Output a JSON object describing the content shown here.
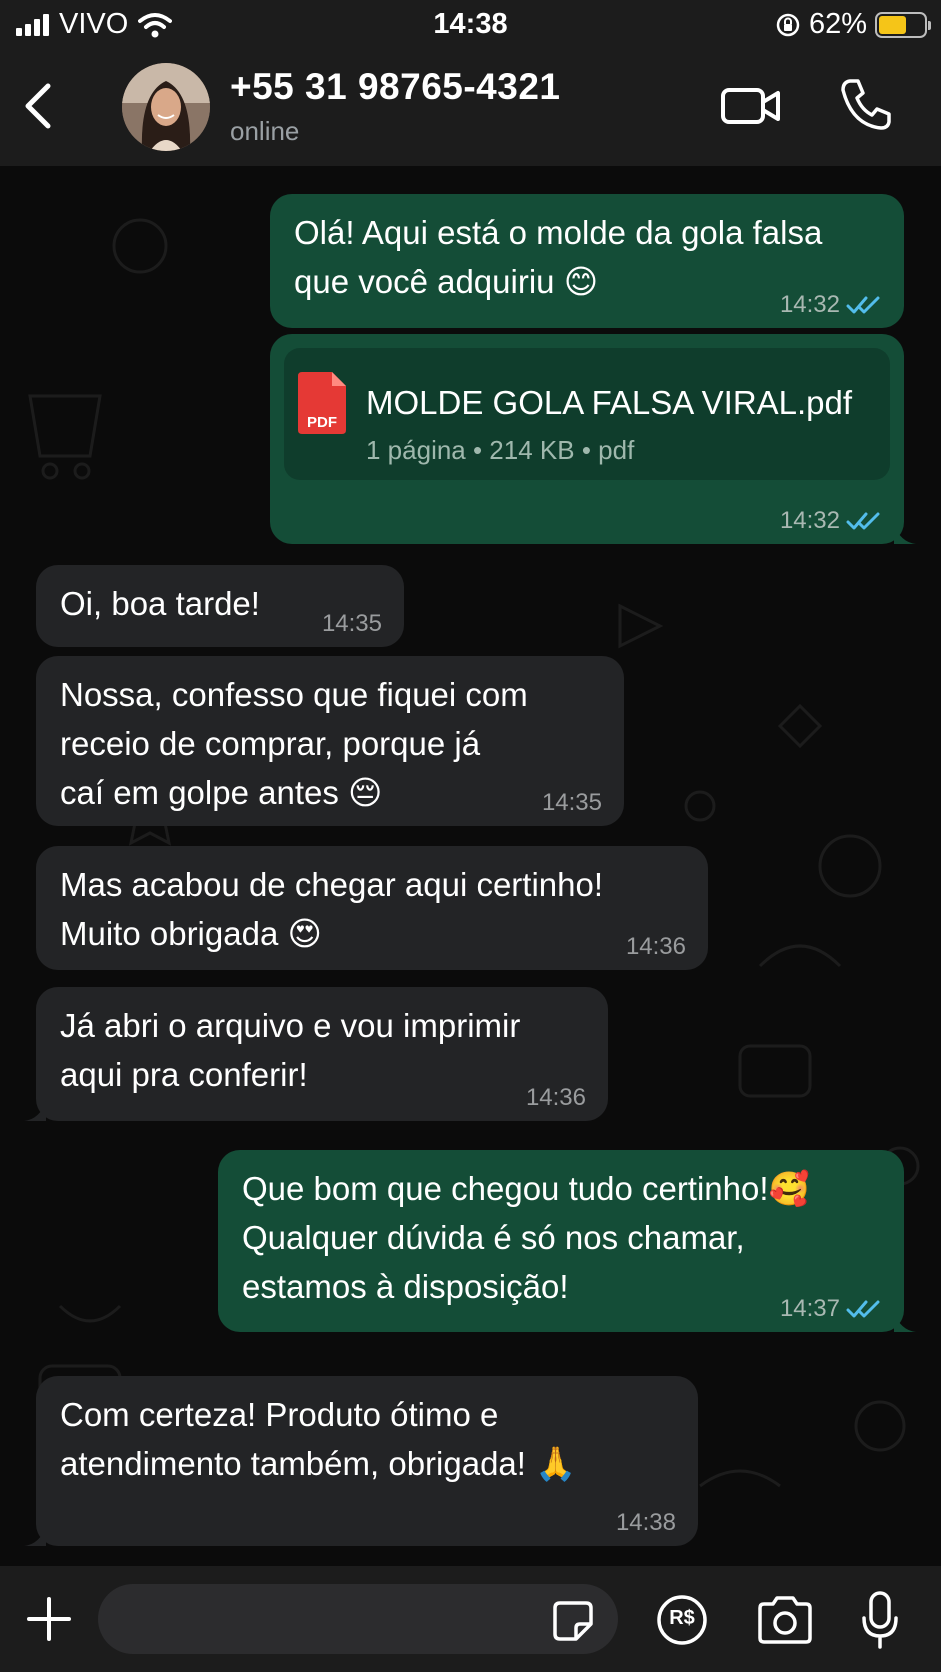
{
  "status_bar": {
    "carrier": "VIVO",
    "time": "14:38",
    "battery_percent": "62%",
    "battery_level": 0.62
  },
  "header": {
    "contact_name": "+55 31 98765-4321",
    "contact_status": "online"
  },
  "messages": [
    {
      "direction": "out",
      "text": "Olá! Aqui está o molde da gola falsa\nque você adquiriu 😊",
      "time": "14:32",
      "read": true
    },
    {
      "direction": "out",
      "type": "file",
      "file_name": "MOLDE GOLA FALSA VIRAL.pdf",
      "file_info": "1 página • 214 KB • pdf",
      "file_badge": "PDF",
      "time": "14:32",
      "read": true
    },
    {
      "direction": "in",
      "text": "Oi, boa tarde!",
      "time": "14:35"
    },
    {
      "direction": "in",
      "text": "Nossa, confesso que fiquei com\nreceio de comprar, porque já\ncaí em golpe antes 😔",
      "time": "14:35"
    },
    {
      "direction": "in",
      "text": "Mas acabou de chegar aqui certinho!\nMuito obrigada 😍",
      "time": "14:36"
    },
    {
      "direction": "in",
      "text": "Já abri o arquivo e vou imprimir\naqui pra conferir!",
      "time": "14:36"
    },
    {
      "direction": "out",
      "text": "Que bom que chegou tudo certinho!🥰\nQualquer dúvida é só nos chamar,\nestamos à disposição!",
      "time": "14:37",
      "read": true
    },
    {
      "direction": "in",
      "text": "Com certeza! Produto ótimo e\natendimento também, obrigada!  🙏",
      "time": "14:38"
    }
  ],
  "composer": {
    "payment_label": "R$"
  },
  "colors": {
    "outgoing_bubble": "#144d37",
    "incoming_bubble": "#232426",
    "read_ticks": "#53bdeb",
    "pdf_red": "#e53935"
  }
}
